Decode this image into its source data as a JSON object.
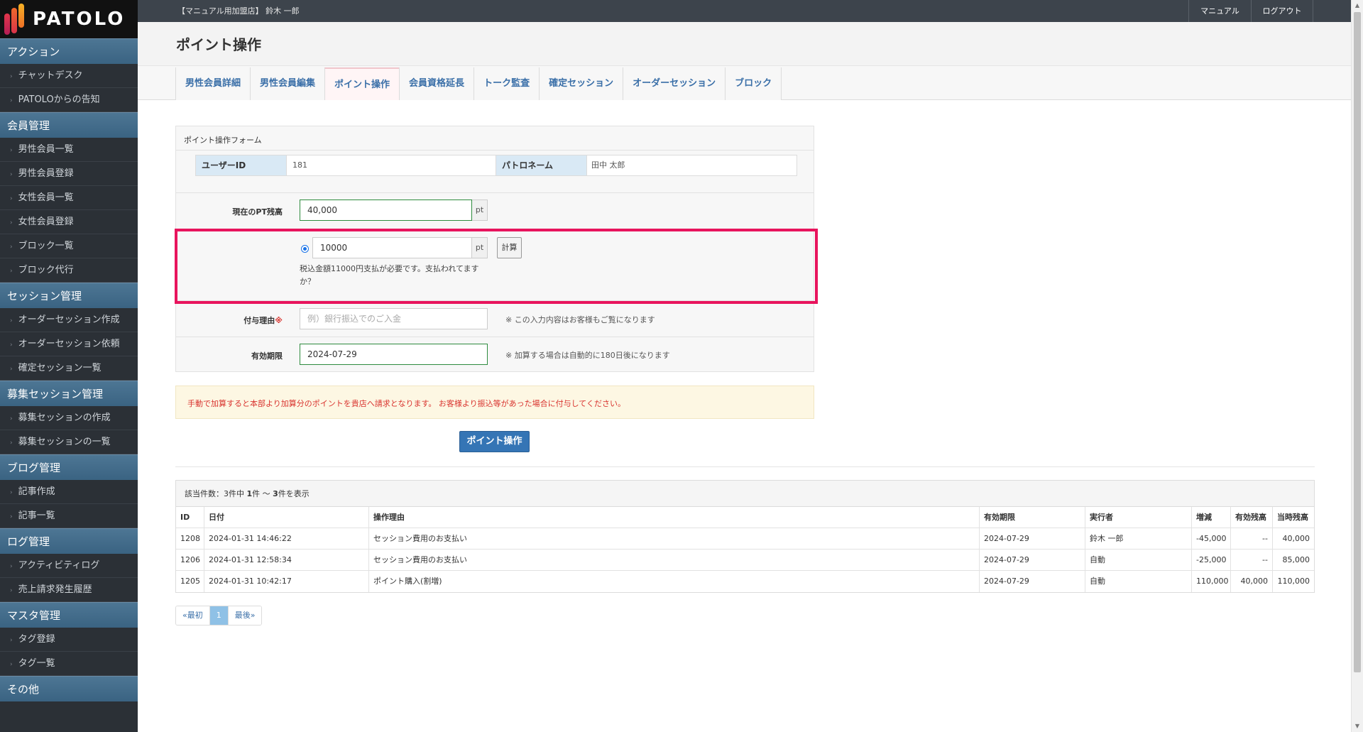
{
  "sidebar": {
    "logo": "PATOLO",
    "sections": [
      {
        "title": "アクション",
        "items": [
          "チャットデスク",
          "PATOLOからの告知"
        ]
      },
      {
        "title": "会員管理",
        "items": [
          "男性会員一覧",
          "男性会員登録",
          "女性会員一覧",
          "女性会員登録",
          "ブロック一覧",
          "ブロック代行"
        ]
      },
      {
        "title": "セッション管理",
        "items": [
          "オーダーセッション作成",
          "オーダーセッション依頼",
          "確定セッション一覧"
        ]
      },
      {
        "title": "募集セッション管理",
        "items": [
          "募集セッションの作成",
          "募集セッションの一覧"
        ]
      },
      {
        "title": "ブログ管理",
        "items": [
          "記事作成",
          "記事一覧"
        ]
      },
      {
        "title": "ログ管理",
        "items": [
          "アクティビティログ",
          "売上請求発生履歴"
        ]
      },
      {
        "title": "マスタ管理",
        "items": [
          "タグ登録",
          "タグ一覧"
        ]
      },
      {
        "title": "その他",
        "items": []
      }
    ]
  },
  "topbar": {
    "user": "【マニュアル用加盟店】 鈴木 一郎",
    "manual": "マニュアル",
    "logout": "ログアウト"
  },
  "page": {
    "title": "ポイント操作"
  },
  "tabs": [
    {
      "label": "男性会員詳細"
    },
    {
      "label": "男性会員編集"
    },
    {
      "label": "ポイント操作"
    },
    {
      "label": "会員資格延長"
    },
    {
      "label": "トーク監査"
    },
    {
      "label": "確定セッション"
    },
    {
      "label": "オーダーセッション"
    },
    {
      "label": "ブロック"
    }
  ],
  "form": {
    "title": "ポイント操作フォーム",
    "user_id_label": "ユーザーID",
    "user_id": "181",
    "patron_label": "パトロネーム",
    "patron_name": "田中 太郎",
    "balance_label": "現在のPT残高",
    "balance": "40,000",
    "unit": "pt",
    "amount": "10000",
    "calc": "計算",
    "tax_note": "税込金額11000円支払が必要です。支払われてます",
    "tax_note2": "か？",
    "reason_label": "付与理由",
    "reason_req": "※",
    "reason_placeholder": "例）銀行振込でのご入金",
    "reason_hint": "※ この入力内容はお客様もご覧になります",
    "expiry_label": "有効期限",
    "expiry": "2024-07-29",
    "expiry_hint": "※ 加算する場合は自動的に180日後になります",
    "warning": "手動で加算すると本部より加算分のポイントを貴店へ請求となります。 お客様より振込等があった場合に付与してください。",
    "submit": "ポイント操作"
  },
  "table": {
    "caption_prefix": "該当件数：3件中 ",
    "caption_from": "1",
    "caption_mid": "件 ～ ",
    "caption_to": "3",
    "caption_suffix": "件を表示",
    "headers": [
      "ID",
      "日付",
      "操作理由",
      "有効期限",
      "実行者",
      "増減",
      "有効残高",
      "当時残高"
    ],
    "rows": [
      [
        "1208",
        "2024-01-31 14:46:22",
        "セッション費用のお支払い",
        "2024-07-29",
        "鈴木 一郎",
        "-45,000",
        "--",
        "40,000"
      ],
      [
        "1206",
        "2024-01-31 12:58:34",
        "セッション費用のお支払い",
        "2024-07-29",
        "自動",
        "-25,000",
        "--",
        "85,000"
      ],
      [
        "1205",
        "2024-01-31 10:42:17",
        "ポイント購入(割増)",
        "2024-07-29",
        "自動",
        "110,000",
        "40,000",
        "110,000"
      ]
    ]
  },
  "pager": {
    "first": "«最初",
    "page": "1",
    "last": "最後»"
  },
  "colors": {
    "accent": "#3575b5",
    "highlight": "#e8145d",
    "sidebar": "#2b3036"
  }
}
